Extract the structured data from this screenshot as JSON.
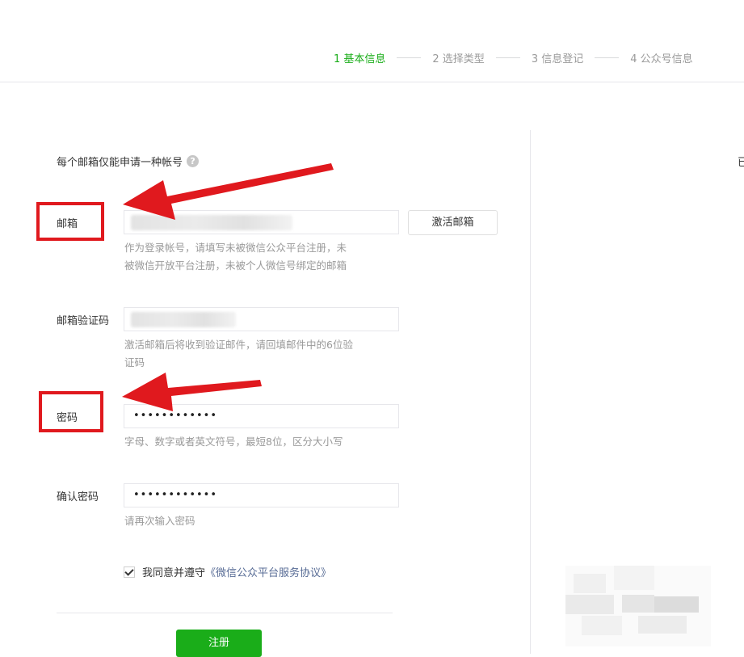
{
  "steps": [
    {
      "label": "1 基本信息",
      "active": true
    },
    {
      "label": "2 选择类型",
      "active": false
    },
    {
      "label": "3 信息登记",
      "active": false
    },
    {
      "label": "4 公众号信息",
      "active": false
    }
  ],
  "notice": {
    "text": "每个邮箱仅能申请一种帐号",
    "icon": "help-question-icon"
  },
  "right_edge_text": "已",
  "form": {
    "email": {
      "label": "邮箱",
      "value": "",
      "activate_button": "激活邮箱",
      "hint_line1": "作为登录帐号，请填写未被微信公众平台注册，未",
      "hint_line2": "被微信开放平台注册，未被个人微信号绑定的邮箱"
    },
    "verify_code": {
      "label": "邮箱验证码",
      "value": "",
      "hint_line1": "激活邮箱后将收到验证邮件，请回填邮件中的6位验",
      "hint_line2": "证码"
    },
    "password": {
      "label": "密码",
      "masked_value": "••••••••••••",
      "hint": "字母、数字或者英文符号，最短8位，区分大小写"
    },
    "confirm_password": {
      "label": "确认密码",
      "masked_value": "••••••••••••",
      "hint": "请再次输入密码"
    },
    "agreement": {
      "checked": true,
      "text": "我同意并遵守",
      "link": "《微信公众平台服务协议》"
    },
    "submit_label": "注册"
  },
  "colors": {
    "accent_green": "#1aad19",
    "annotation_red": "#e0191e",
    "link_blue": "#576b95",
    "hint_gray": "#9a9a9a"
  }
}
